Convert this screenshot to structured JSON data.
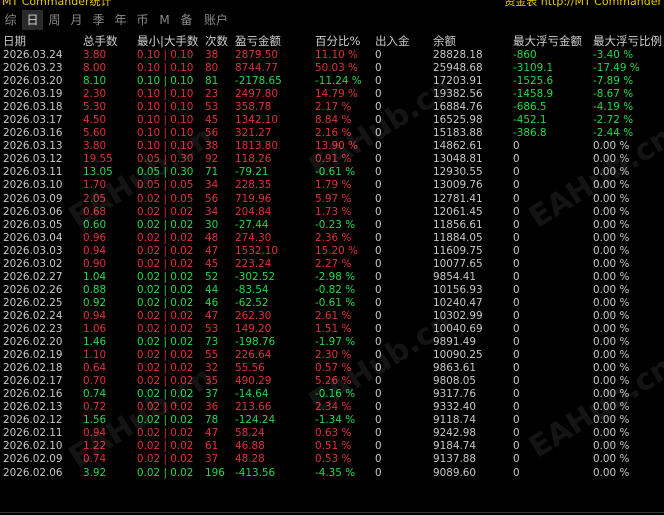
{
  "topbar": {
    "left": "MT Commander统计",
    "right": "资金表 http://MT Commander"
  },
  "tabs": [
    "综",
    "日",
    "周",
    "月",
    "季",
    "年",
    "币",
    "M",
    "备",
    "账户"
  ],
  "headers": [
    "日期",
    "总手数",
    "最小|大手数",
    "次数",
    "盈亏金额",
    "百分比%",
    "出入金",
    "余额",
    "最大浮亏金额",
    "最大浮亏比例"
  ],
  "rows": [
    [
      "2026.03.24",
      "3.80",
      "0.10 | 0.10",
      "38",
      "2879.50",
      "11.10 %",
      "0",
      "28828.18",
      "-860",
      "-3.40 %"
    ],
    [
      "2026.03.23",
      "8.00",
      "0.10 | 0.10",
      "80",
      "8744.77",
      "50.03 %",
      "0",
      "25948.68",
      "-3109.1",
      "-17.49 %"
    ],
    [
      "2026.03.20",
      "8.10",
      "0.10 | 0.10",
      "81",
      "-2178.65",
      "-11.24 %",
      "0",
      "17203.91",
      "-1525.6",
      "-7.89 %"
    ],
    [
      "2026.03.19",
      "2.30",
      "0.10 | 0.10",
      "23",
      "2497.80",
      "14.79 %",
      "0",
      "19382.56",
      "-1458.9",
      "-8.67 %"
    ],
    [
      "2026.03.18",
      "5.30",
      "0.10 | 0.10",
      "53",
      "358.78",
      "2.17 %",
      "0",
      "16884.76",
      "-686.5",
      "-4.19 %"
    ],
    [
      "2026.03.17",
      "4.50",
      "0.10 | 0.10",
      "45",
      "1342.10",
      "8.84 %",
      "0",
      "16525.98",
      "-452.1",
      "-2.72 %"
    ],
    [
      "2026.03.16",
      "5.60",
      "0.10 | 0.10",
      "56",
      "321.27",
      "2.16 %",
      "0",
      "15183.88",
      "-386.8",
      "-2.44 %"
    ],
    [
      "2026.03.13",
      "3.80",
      "0.10 | 0.10",
      "38",
      "1813.80",
      "13.90 %",
      "0",
      "14862.61",
      "0",
      "0.00 %"
    ],
    [
      "2026.03.12",
      "19.55",
      "0.05 | 0.30",
      "92",
      "118.26",
      "0.91 %",
      "0",
      "13048.81",
      "0",
      "0.00 %"
    ],
    [
      "2026.03.11",
      "13.05",
      "0.05 | 0.30",
      "71",
      "-79.21",
      "-0.61 %",
      "0",
      "12930.55",
      "0",
      "0.00 %"
    ],
    [
      "2026.03.10",
      "1.70",
      "0.05 | 0.05",
      "34",
      "228.35",
      "1.79 %",
      "0",
      "13009.76",
      "0",
      "0.00 %"
    ],
    [
      "2026.03.09",
      "2.05",
      "0.02 | 0.05",
      "56",
      "719.96",
      "5.97 %",
      "0",
      "12781.41",
      "0",
      "0.00 %"
    ],
    [
      "2026.03.06",
      "0.68",
      "0.02 | 0.02",
      "34",
      "204.84",
      "1.73 %",
      "0",
      "12061.45",
      "0",
      "0.00 %"
    ],
    [
      "2026.03.05",
      "0.60",
      "0.02 | 0.02",
      "30",
      "-27.44",
      "-0.23 %",
      "0",
      "11856.61",
      "0",
      "0.00 %"
    ],
    [
      "2026.03.04",
      "0.96",
      "0.02 | 0.02",
      "48",
      "274.30",
      "2.36 %",
      "0",
      "11884.05",
      "0",
      "0.00 %"
    ],
    [
      "2026.03.03",
      "0.94",
      "0.02 | 0.02",
      "47",
      "1532.10",
      "15.20 %",
      "0",
      "11609.75",
      "0",
      "0.00 %"
    ],
    [
      "2026.03.02",
      "0.90",
      "0.02 | 0.02",
      "45",
      "223.24",
      "2.27 %",
      "0",
      "10077.65",
      "0",
      "0.00 %"
    ],
    [
      "2026.02.27",
      "1.04",
      "0.02 | 0.02",
      "52",
      "-302.52",
      "-2.98 %",
      "0",
      "9854.41",
      "0",
      "0.00 %"
    ],
    [
      "2026.02.26",
      "0.88",
      "0.02 | 0.02",
      "44",
      "-83.54",
      "-0.82 %",
      "0",
      "10156.93",
      "0",
      "0.00 %"
    ],
    [
      "2026.02.25",
      "0.92",
      "0.02 | 0.02",
      "46",
      "-62.52",
      "-0.61 %",
      "0",
      "10240.47",
      "0",
      "0.00 %"
    ],
    [
      "2026.02.24",
      "0.94",
      "0.02 | 0.02",
      "47",
      "262.30",
      "2.61 %",
      "0",
      "10302.99",
      "0",
      "0.00 %"
    ],
    [
      "2026.02.23",
      "1.06",
      "0.02 | 0.02",
      "53",
      "149.20",
      "1.51 %",
      "0",
      "10040.69",
      "0",
      "0.00 %"
    ],
    [
      "2026.02.20",
      "1.46",
      "0.02 | 0.02",
      "73",
      "-198.76",
      "-1.97 %",
      "0",
      "9891.49",
      "0",
      "0.00 %"
    ],
    [
      "2026.02.19",
      "1.10",
      "0.02 | 0.02",
      "55",
      "226.64",
      "2.30 %",
      "0",
      "10090.25",
      "0",
      "0.00 %"
    ],
    [
      "2026.02.18",
      "0.64",
      "0.02 | 0.02",
      "32",
      "55.56",
      "0.57 %",
      "0",
      "9863.61",
      "0",
      "0.00 %"
    ],
    [
      "2026.02.17",
      "0.70",
      "0.02 | 0.02",
      "35",
      "490.29",
      "5.26 %",
      "0",
      "9808.05",
      "0",
      "0.00 %"
    ],
    [
      "2026.02.16",
      "0.74",
      "0.02 | 0.02",
      "37",
      "-14.64",
      "-0.16 %",
      "0",
      "9317.76",
      "0",
      "0.00 %"
    ],
    [
      "2026.02.13",
      "0.72",
      "0.02 | 0.02",
      "36",
      "213.66",
      "2.34 %",
      "0",
      "9332.40",
      "0",
      "0.00 %"
    ],
    [
      "2026.02.12",
      "1.56",
      "0.02 | 0.02",
      "78",
      "-124.24",
      "-1.34 %",
      "0",
      "9118.74",
      "0",
      "0.00 %"
    ],
    [
      "2026.02.11",
      "0.94",
      "0.02 | 0.02",
      "47",
      "58.24",
      "0.63 %",
      "0",
      "9242.98",
      "0",
      "0.00 %"
    ],
    [
      "2026.02.10",
      "1.22",
      "0.02 | 0.02",
      "61",
      "46.88",
      "0.51 %",
      "0",
      "9184.74",
      "0",
      "0.00 %"
    ],
    [
      "2026.02.09",
      "0.74",
      "0.02 | 0.02",
      "37",
      "48.28",
      "0.53 %",
      "0",
      "9137.88",
      "0",
      "0.00 %"
    ],
    [
      "2026.02.06",
      "3.92",
      "0.02 | 0.02",
      "196",
      "-413.56",
      "-4.35 %",
      "0",
      "9089.60",
      "0",
      "0.00 %"
    ]
  ],
  "watermark": "EAHub.cn",
  "colors": {
    "red": "#e0303a",
    "green": "#26d84a",
    "white": "#c8c8c8",
    "bg": "#000000",
    "accent": "#e8c800"
  }
}
